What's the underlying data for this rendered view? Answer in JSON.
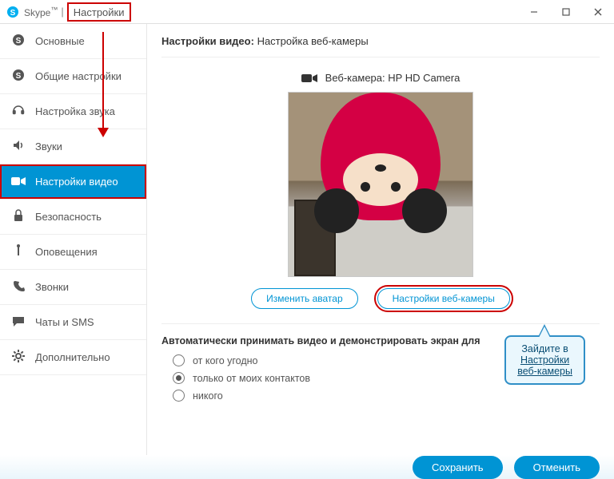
{
  "title": {
    "app": "Skype",
    "section": "Настройки"
  },
  "sidebar": {
    "items": [
      {
        "label": "Основные"
      },
      {
        "label": "Общие настройки"
      },
      {
        "label": "Настройка звука"
      },
      {
        "label": "Звуки"
      },
      {
        "label": "Настройки видео"
      },
      {
        "label": "Безопасность"
      },
      {
        "label": "Оповещения"
      },
      {
        "label": "Звонки"
      },
      {
        "label": "Чаты и SMS"
      },
      {
        "label": "Дополнительно"
      }
    ]
  },
  "content": {
    "heading_bold": "Настройки видео:",
    "heading_rest": "Настройка веб-камеры",
    "webcam_label_prefix": "Веб-камера:",
    "webcam_name": "HP HD Camera",
    "btn_avatar": "Изменить аватар",
    "btn_settings": "Настройки веб-камеры",
    "auto_title": "Автоматически принимать видео и демонстрировать экран для",
    "radios": [
      {
        "label": "от кого угодно"
      },
      {
        "label": "только от моих контактов"
      },
      {
        "label": "никого"
      }
    ]
  },
  "footer": {
    "save": "Сохранить",
    "cancel": "Отменить"
  },
  "callout": {
    "line1": "Зайдите в",
    "line2": "Настройки",
    "line3": "веб-камеры"
  }
}
